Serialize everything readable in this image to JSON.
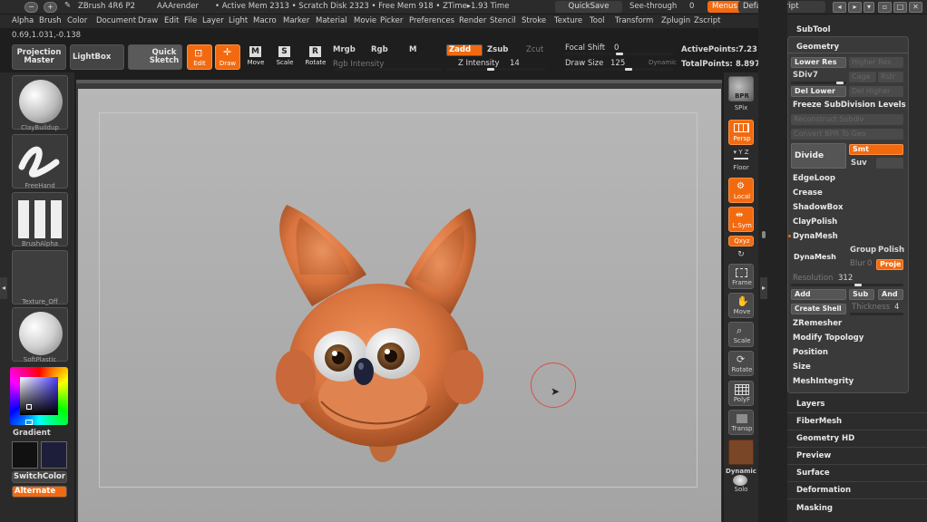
{
  "titlebar": {
    "app": "ZBrush 4R6 P2",
    "doc": "AAArender",
    "status": "• Active Mem 2313 • Scratch Disk 2323 • Free Mem 918 • ZTime▸1.93 Time",
    "quicksave": "QuickSave",
    "seethrough_label": "See-through",
    "seethrough_value": "0",
    "menus": "Menus",
    "script": "DefaultZScript"
  },
  "menubar": [
    "Alpha",
    "Brush",
    "Color",
    "Document",
    "Draw",
    "Edit",
    "File",
    "Layer",
    "Light",
    "Macro",
    "Marker",
    "Material",
    "Movie",
    "Picker",
    "Preferences",
    "Render",
    "Stencil",
    "Stroke",
    "Texture",
    "Tool",
    "Transform",
    "Zplugin",
    "Zscript"
  ],
  "coords": "0.69,1.031,-0.138",
  "toolbar": {
    "projection_master": "Projection Master",
    "lightbox": "LightBox",
    "quick_sketch": "Quick Sketch",
    "edit": "Edit",
    "draw": "Draw",
    "move": "Move",
    "scale": "Scale",
    "rotate": "Rotate",
    "mrgb": "Mrgb",
    "rgb": "Rgb",
    "m": "M",
    "rgb_intensity": "Rgb Intensity",
    "zadd": "Zadd",
    "zsub": "Zsub",
    "zcut": "Zcut",
    "z_intensity_label": "Z Intensity",
    "z_intensity_value": "14",
    "focal_shift_label": "Focal Shift",
    "focal_shift_value": "0",
    "draw_size_label": "Draw Size",
    "draw_size_value": "125",
    "dynamic": "Dynamic",
    "active_points_label": "ActivePoints:",
    "active_points_value": "7.23",
    "total_points_label": "TotalPoints:",
    "total_points_value": "8.897"
  },
  "left_shelf": {
    "brushes": [
      "ClayBuildup",
      "FreeHand",
      "BrushAlpha",
      "Texture_Off",
      "SoftPlastic"
    ],
    "gradient": "Gradient",
    "switch_color": "SwitchColor",
    "alternate": "Alternate",
    "colors": {
      "main": "#111111",
      "secondary": "#1d1f3a"
    }
  },
  "right_shelf": {
    "bpr": "BPR",
    "spix": "SPix",
    "persp": "Persp",
    "floor": "Floor",
    "local": "Local",
    "lsym": "L.Sym",
    "xyz": "Qxyz",
    "frame": "Frame",
    "move": "Move",
    "scale": "Scale",
    "rotate": "Rotate",
    "polyf": "PolyF",
    "transp": "Transp",
    "dynamic": "Dynamic",
    "solo": "Solo"
  },
  "panel": {
    "subtool": "SubTool",
    "geometry": "Geometry",
    "lower_res": "Lower Res",
    "higher_res": "Higher Res",
    "sdiv_label": "SDiv",
    "sdiv_value": "7",
    "cage": "Cage",
    "rstr": "Rstr",
    "del_lower": "Del Lower",
    "del_higher": "Del Higher",
    "freeze": "Freeze SubDivision Levels",
    "reconstruct": "Reconstruct Subdiv",
    "convert_bpr": "Convert BPR To Geo",
    "divide": "Divide",
    "smt": "Smt",
    "suv": "Suv",
    "rsmt": "ReUV",
    "edgeloop": "EdgeLoop",
    "crease": "Crease",
    "shadowbox": "ShadowBox",
    "claypolish": "ClayPolish",
    "dynamesh_header": "DynaMesh",
    "dynamesh_btn": "DynaMesh",
    "group": "Group",
    "polish": "Polish",
    "blur_label": "Blur",
    "blur_value": "0",
    "project": "Proje",
    "resolution_label": "Resolution",
    "resolution_value": "312",
    "add": "Add",
    "sub": "Sub",
    "and": "And",
    "create_shell": "Create Shell",
    "thickness_label": "Thickness",
    "thickness_value": "4",
    "zremesher": "ZRemesher",
    "modify_topology": "Modify Topology",
    "position": "Position",
    "size": "Size",
    "meshintegrity": "MeshIntegrity",
    "layers": "Layers",
    "fibermesh": "FiberMesh",
    "geometry_hd": "Geometry HD",
    "preview": "Preview",
    "surface": "Surface",
    "deformation": "Deformation",
    "masking": "Masking"
  },
  "accent": "#f26a10",
  "model_color": "#d9743f"
}
